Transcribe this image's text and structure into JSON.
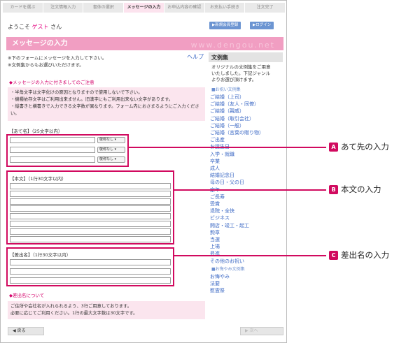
{
  "steps": [
    "カードを選ぶ",
    "注文情報入力",
    "書体の選択",
    "メッセージの入力",
    "お申込内容の確認",
    "お支払い手続き",
    "注文完了"
  ],
  "active_step": 3,
  "welcome": {
    "prefix": "ようこそ",
    "guest": "ゲスト",
    "suffix": "さん"
  },
  "buttons": {
    "register": "▶新規会員登録",
    "login": "▶ログイン",
    "back": "◀ 戻る",
    "next": "▶ 次へ"
  },
  "title": "メッセージの入力",
  "title_watermark": "www.dengou.net",
  "notes": [
    "※下のフォームにメッセージを入力して下さい。",
    "※文例集からもお選びいただけます。"
  ],
  "help": "ヘルプ",
  "caution": {
    "heading": "◆メッセージの入力に付きましてのご注意",
    "lines": [
      "・半角文字は文字化けの原因となりますので使用しないで下さい。",
      "・機種依存文字はご利用出来ません。旧漢字にもご利用出来ない文字があります。",
      "・縦書きと横書きで入力できる文字数が異なります。フォーム内におさまるようにご入力ください。"
    ]
  },
  "atena": {
    "label": "【あて名】（25文字以内）",
    "select_value": "敬称なし"
  },
  "honbun": {
    "label": "【本文】（1行30文字以内）"
  },
  "sashidashi": {
    "label": "【差出名】（1行30文字以内）"
  },
  "sashidashi_note": {
    "heading": "◆差出名について",
    "lines": [
      "ご住所や会社名が入れられるよう、3行ご用意しております。",
      "必要に応じてご利用ください。1行の最大文字数は30文字です。"
    ]
  },
  "sidebar": {
    "title": "文例集",
    "desc": [
      "オリジナルの文例集をご用意",
      "いたしました。下記ジャンル",
      "よりお選び頂けます。"
    ],
    "cat_celebration": "■お祝い文例集",
    "celebration": [
      "ご結婚（上司）",
      "ご結婚（友人・同僚）",
      "ご結婚（親戚）",
      "ご結婚（取引会社）",
      "ご結婚（一般）",
      "ご結婚（言葉の贈り物）",
      "ご出産",
      "お誕生日",
      "入学・就職",
      "卒業",
      "成人",
      "結婚記念日",
      "母の日・父の日",
      "定年",
      "ご長寿",
      "受賞",
      "退院・全快",
      "ビジネス",
      "開店・竣工・起工",
      "勲章",
      "当選",
      "上場",
      "昇進",
      "その他のお祝い"
    ],
    "cat_condolence": "■お悔やみ文例集",
    "condolence": [
      "お悔やみ",
      "法要",
      "慰霊祭"
    ]
  },
  "callouts": [
    {
      "badge": "A",
      "text": "あて先の入力"
    },
    {
      "badge": "B",
      "text": "本文の入力"
    },
    {
      "badge": "C",
      "text": "差出名の入力"
    }
  ],
  "colors": {
    "accent": "#d10a5f",
    "title_bg": "#f19ec2",
    "link": "#3b68c4"
  }
}
